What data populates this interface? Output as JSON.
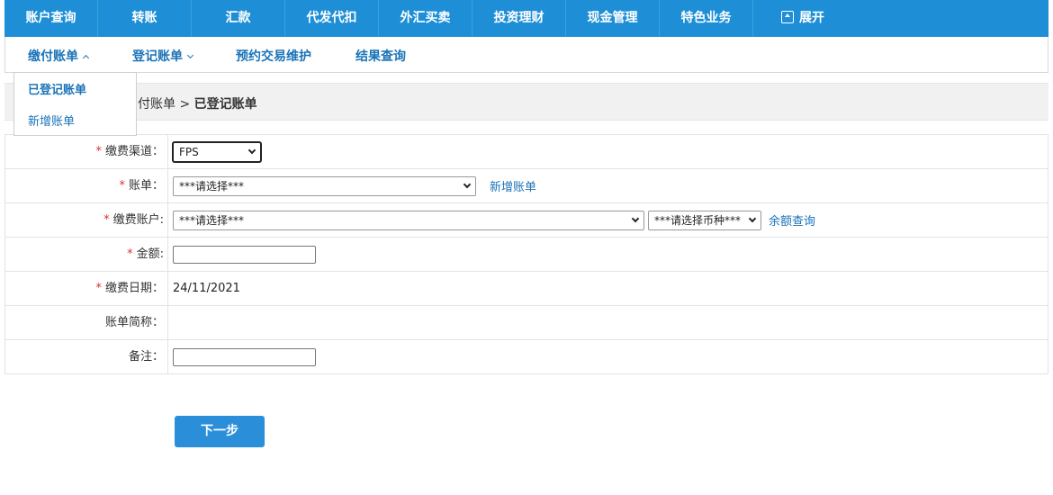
{
  "topnav": {
    "items": [
      "账户查询",
      "转账",
      "汇款",
      "代发代扣",
      "外汇买卖",
      "投资理财",
      "现金管理",
      "特色业务"
    ],
    "expand_label": "展开"
  },
  "subnav": {
    "items": [
      "缴付账单",
      "登记账单",
      "预约交易维护",
      "结果查询"
    ]
  },
  "dropdown": {
    "items": [
      "已登记账单",
      "新增账单"
    ]
  },
  "breadcrumb": {
    "parent": "付账单",
    "separator": " > ",
    "current": "已登记账单"
  },
  "form": {
    "channel": {
      "label": "缴费渠道：",
      "value": "FPS"
    },
    "bill": {
      "label": "账单：",
      "value": "***请选择***",
      "link": "新增账单"
    },
    "account": {
      "label": "缴费账户:",
      "value": "***请选择***",
      "currency": "***请选择币种***",
      "link": "余额查询"
    },
    "amount": {
      "label": "金额:",
      "value": ""
    },
    "date": {
      "label": "缴费日期：",
      "value": "24/11/2021"
    },
    "bill_short_name": {
      "label": "账单简称：",
      "value": ""
    },
    "remark": {
      "label": "备注：",
      "value": ""
    },
    "required_mark": "*"
  },
  "actions": {
    "next_label": "下一步"
  },
  "colors": {
    "primary": "#1e8fd6",
    "link": "#1a73b8",
    "required": "#d9342b"
  }
}
